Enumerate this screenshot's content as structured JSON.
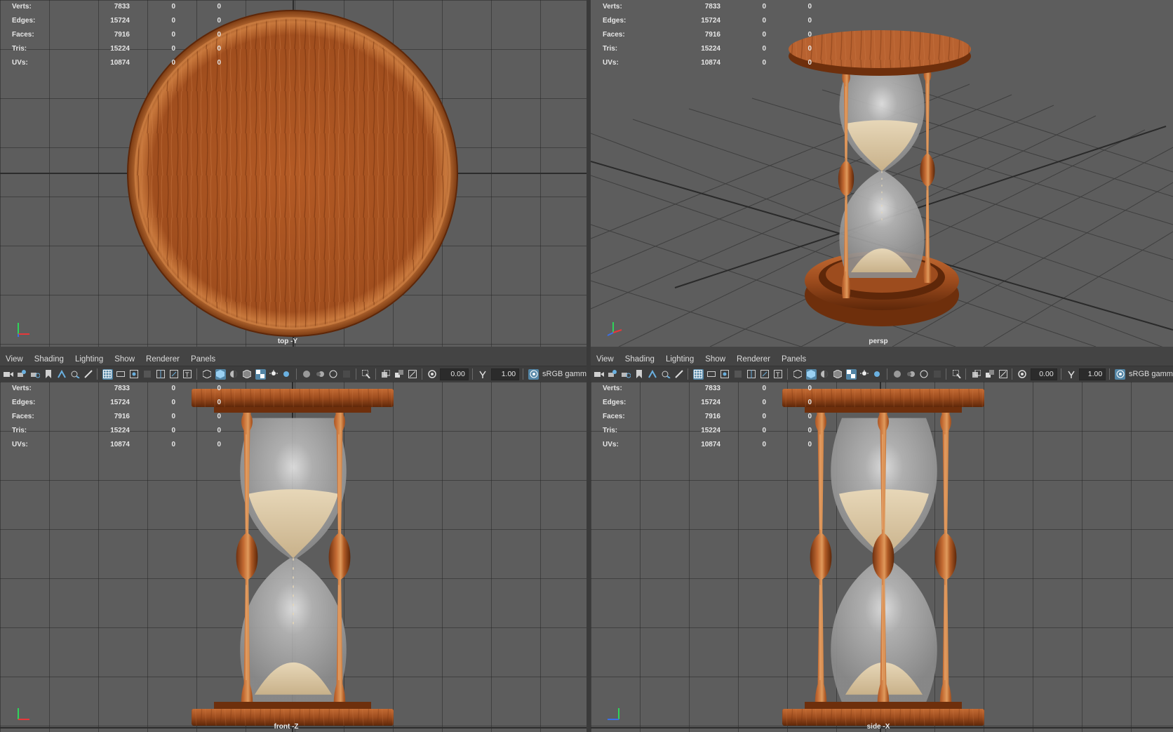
{
  "menus": [
    "View",
    "Shading",
    "Lighting",
    "Show",
    "Renderer",
    "Panels"
  ],
  "toolbar": {
    "exposure": "0.00",
    "gamma": "1.00",
    "color_space": "sRGB gamm"
  },
  "hud": {
    "rows": [
      {
        "label": "Verts:",
        "total": "7833",
        "selected": "0",
        "components": "0"
      },
      {
        "label": "Edges:",
        "total": "15724",
        "selected": "0",
        "components": "0"
      },
      {
        "label": "Faces:",
        "total": "7916",
        "selected": "0",
        "components": "0"
      },
      {
        "label": "Tris:",
        "total": "15224",
        "selected": "0",
        "components": "0"
      },
      {
        "label": "UVs:",
        "total": "10874",
        "selected": "0",
        "components": "0"
      }
    ]
  },
  "viewports": {
    "top": {
      "camera": "top -Y"
    },
    "persp": {
      "camera": "persp"
    },
    "front": {
      "camera": "front -Z"
    },
    "side": {
      "camera": "side -X"
    }
  },
  "colors": {
    "viewport_bg": "#5d5d5d",
    "wood_dark": "#7a3a12",
    "wood_mid": "#a85526",
    "wood_light": "#c66f35",
    "sand": "#d9c6a6",
    "glass": "#a9a9a9",
    "active_icon": "#5285a6"
  }
}
